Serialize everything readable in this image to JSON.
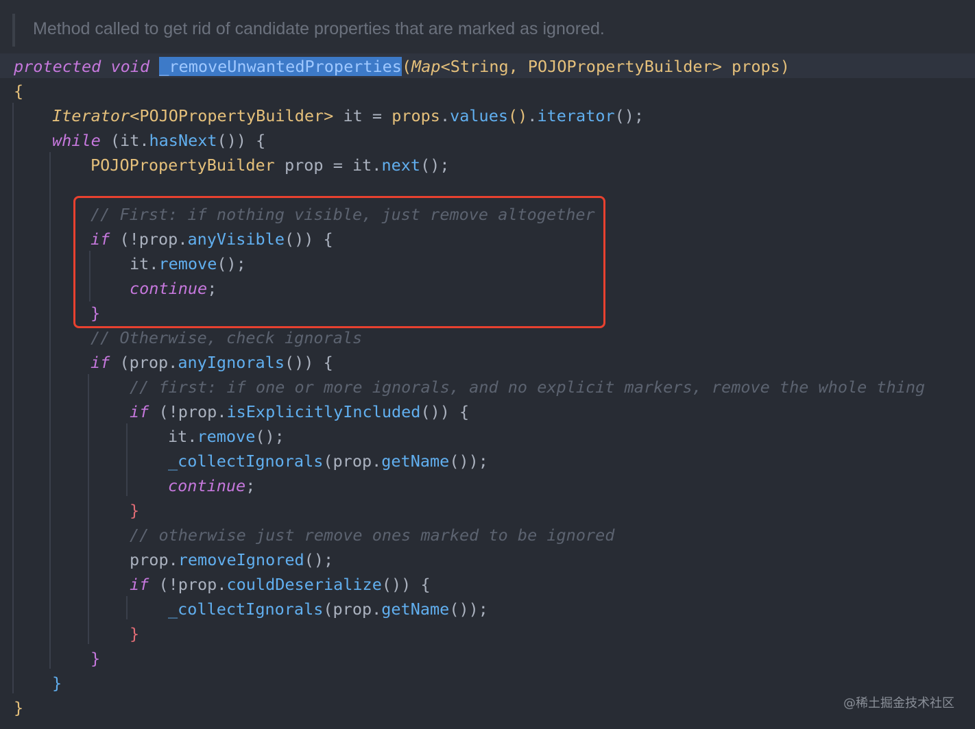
{
  "doc_comment": "Method called to get rid of candidate properties that are marked as ignored.",
  "code": {
    "signature": {
      "mod1": "protected",
      "mod2": "void",
      "method": "_removeUnwantedProperties",
      "open": "(",
      "type1": "Map",
      "generic": "<String, POJOPropertyBuilder>",
      "param": "props",
      "close": ")"
    },
    "lines": {
      "l_open": "{",
      "l_iter_type": "Iterator",
      "l_iter_gen": "<POJOPropertyBuilder>",
      "l_iter_rest1": " it = ",
      "l_iter_props": "props",
      "l_iter_dot1": ".",
      "l_iter_values": "values",
      "l_iter_p1": "()",
      "l_iter_dot2": ".",
      "l_iter_iterator": "iterator",
      "l_iter_p2": "();",
      "l_while": "while",
      "l_while_rest1": " (it.",
      "l_while_fn": "hasNext",
      "l_while_rest2": "()) {",
      "l_prop_type": "POJOPropertyBuilder",
      "l_prop_rest": " prop = it.",
      "l_prop_fn": "next",
      "l_prop_end": "();",
      "c1": "// First: if nothing visible, just remove altogether",
      "if1_kw": "if",
      "if1_rest1": " (!prop.",
      "if1_fn": "anyVisible",
      "if1_rest2": "()) {",
      "rm1_a": "it.",
      "rm1_fn": "remove",
      "rm1_b": "();",
      "cont1_kw": "continue",
      "cont1_b": ";",
      "close1": "}",
      "c2": "// Otherwise, check ignorals",
      "if2_kw": "if",
      "if2_rest1": " (prop.",
      "if2_fn": "anyIgnorals",
      "if2_rest2": "()) {",
      "c3": "// first: if one or more ignorals, and no explicit markers, remove the whole thing",
      "if3_kw": "if",
      "if3_rest1": " (!prop.",
      "if3_fn": "isExplicitlyIncluded",
      "if3_rest2": "()) {",
      "rm2_a": "it.",
      "rm2_fn": "remove",
      "rm2_b": "();",
      "ci1_fn": "_collectIgnorals",
      "ci1_a": "(prop.",
      "ci1_fn2": "getName",
      "ci1_b": "());",
      "cont2_kw": "continue",
      "cont2_b": ";",
      "close2": "}",
      "c4": "// otherwise just remove ones marked to be ignored",
      "ri_a": "prop.",
      "ri_fn": "removeIgnored",
      "ri_b": "();",
      "if4_kw": "if",
      "if4_rest1": " (!prop.",
      "if4_fn": "couldDeserialize",
      "if4_rest2": "()) {",
      "ci2_fn": "_collectIgnorals",
      "ci2_a": "(prop.",
      "ci2_fn2": "getName",
      "ci2_b": "());",
      "close3": "}",
      "close4": "}",
      "close5": "}",
      "close6": "}"
    }
  },
  "watermark": "@稀土掘金技术社区",
  "colors": {
    "background": "#282c34",
    "highlight_box": "#e8412f",
    "keyword": "#c678dd",
    "type": "#e5c07b",
    "function": "#61afef",
    "comment": "#5c6370"
  }
}
